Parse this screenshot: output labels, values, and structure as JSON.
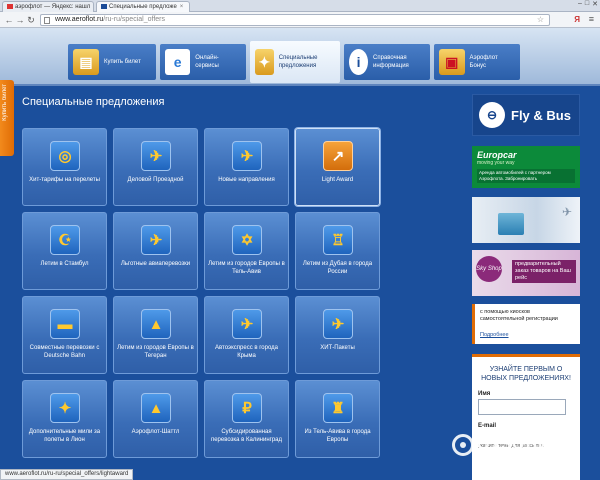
{
  "browser": {
    "tabs": [
      {
        "label": "аэрофлот — Яндекс: нашл"
      },
      {
        "label": "Специальные предложе"
      }
    ],
    "url_host": "www.aeroflot.ru",
    "url_path": "/ru-ru/special_offers",
    "status_url": "www.aeroflot.ru/ru-ru/special_offers/lightaward"
  },
  "nav": [
    {
      "label": "Купить билет",
      "icon": "tickets-icon"
    },
    {
      "label": "Онлайн-сервисы",
      "icon": "online-services-icon"
    },
    {
      "label": "Специальные предложения",
      "icon": "special-offers-icon"
    },
    {
      "label": "Справочная информация",
      "icon": "info-icon"
    },
    {
      "label": "Аэрофлот Бонус",
      "icon": "gift-icon"
    }
  ],
  "side_tab": "Купить билет",
  "page_title": "Специальные предложения",
  "tiles": [
    {
      "label": "Хит-тарифы на перелеты",
      "icon": "globe-icon",
      "glyph": "◎"
    },
    {
      "label": "Деловой Проездной",
      "icon": "ticket-plane-icon",
      "glyph": "✈"
    },
    {
      "label": "Новые направления",
      "icon": "map-plane-icon",
      "glyph": "✈"
    },
    {
      "label": "Light Award",
      "icon": "light-award-icon",
      "glyph": "↗"
    },
    {
      "label": "Летим в Стамбул",
      "icon": "mosque-icon",
      "glyph": "☪"
    },
    {
      "label": "Льготные авиаперевозки",
      "icon": "russia-map-icon",
      "glyph": "✈"
    },
    {
      "label": "Летим из городов Европы в Тель-Авив",
      "icon": "menorah-icon",
      "glyph": "✡"
    },
    {
      "label": "Летим из Дубая в города России",
      "icon": "samovar-icon",
      "glyph": "♖"
    },
    {
      "label": "Совместные перевозки с Deutsche Bahn",
      "icon": "train-icon",
      "glyph": "▬"
    },
    {
      "label": "Летим из городов Европы в Тегеран",
      "icon": "tower-icon",
      "glyph": "▲"
    },
    {
      "label": "Автоэкспресс в города Крыма",
      "icon": "bus-plane-icon",
      "glyph": "✈"
    },
    {
      "label": "ХИТ-Пакеты",
      "icon": "plane-car-icon",
      "glyph": "✈"
    },
    {
      "label": "Дополнительные мили за полеты в Лион",
      "icon": "miles-ticket-icon",
      "glyph": "✦"
    },
    {
      "label": "Аэрофлот-Шаттл",
      "icon": "rocket-icon",
      "glyph": "▲"
    },
    {
      "label": "Субсидированная перевозка в Калининград",
      "icon": "ruble-plane-icon",
      "glyph": "₽"
    },
    {
      "label": "Из Тель-Авива в города Европы",
      "icon": "big-ben-icon",
      "glyph": "♜"
    }
  ],
  "ads": {
    "fly_bus": "Fly & Bus",
    "europcar_brand": "Europcar",
    "europcar_slogan": "moving your way",
    "europcar_desc": "Аренда автомобилей с партнером Аэрофлота. Забронировать",
    "sky_logo": "Sky Shop",
    "sky_text": "предварительный заказ товаров на Ваш рейс",
    "kiosk_text": "с помощью киосков самостоятельной регистрации",
    "kiosk_link": "Подробнее"
  },
  "subscribe": {
    "title": "УЗНАЙТЕ ПЕРВЫМ О НОВЫХ ПРЕДЛОЖЕНИЯХ!",
    "name_label": "Имя",
    "email_label": "E-mail",
    "note": "укажите темы для рассылки"
  },
  "watermark": "ОТЗОВИК"
}
